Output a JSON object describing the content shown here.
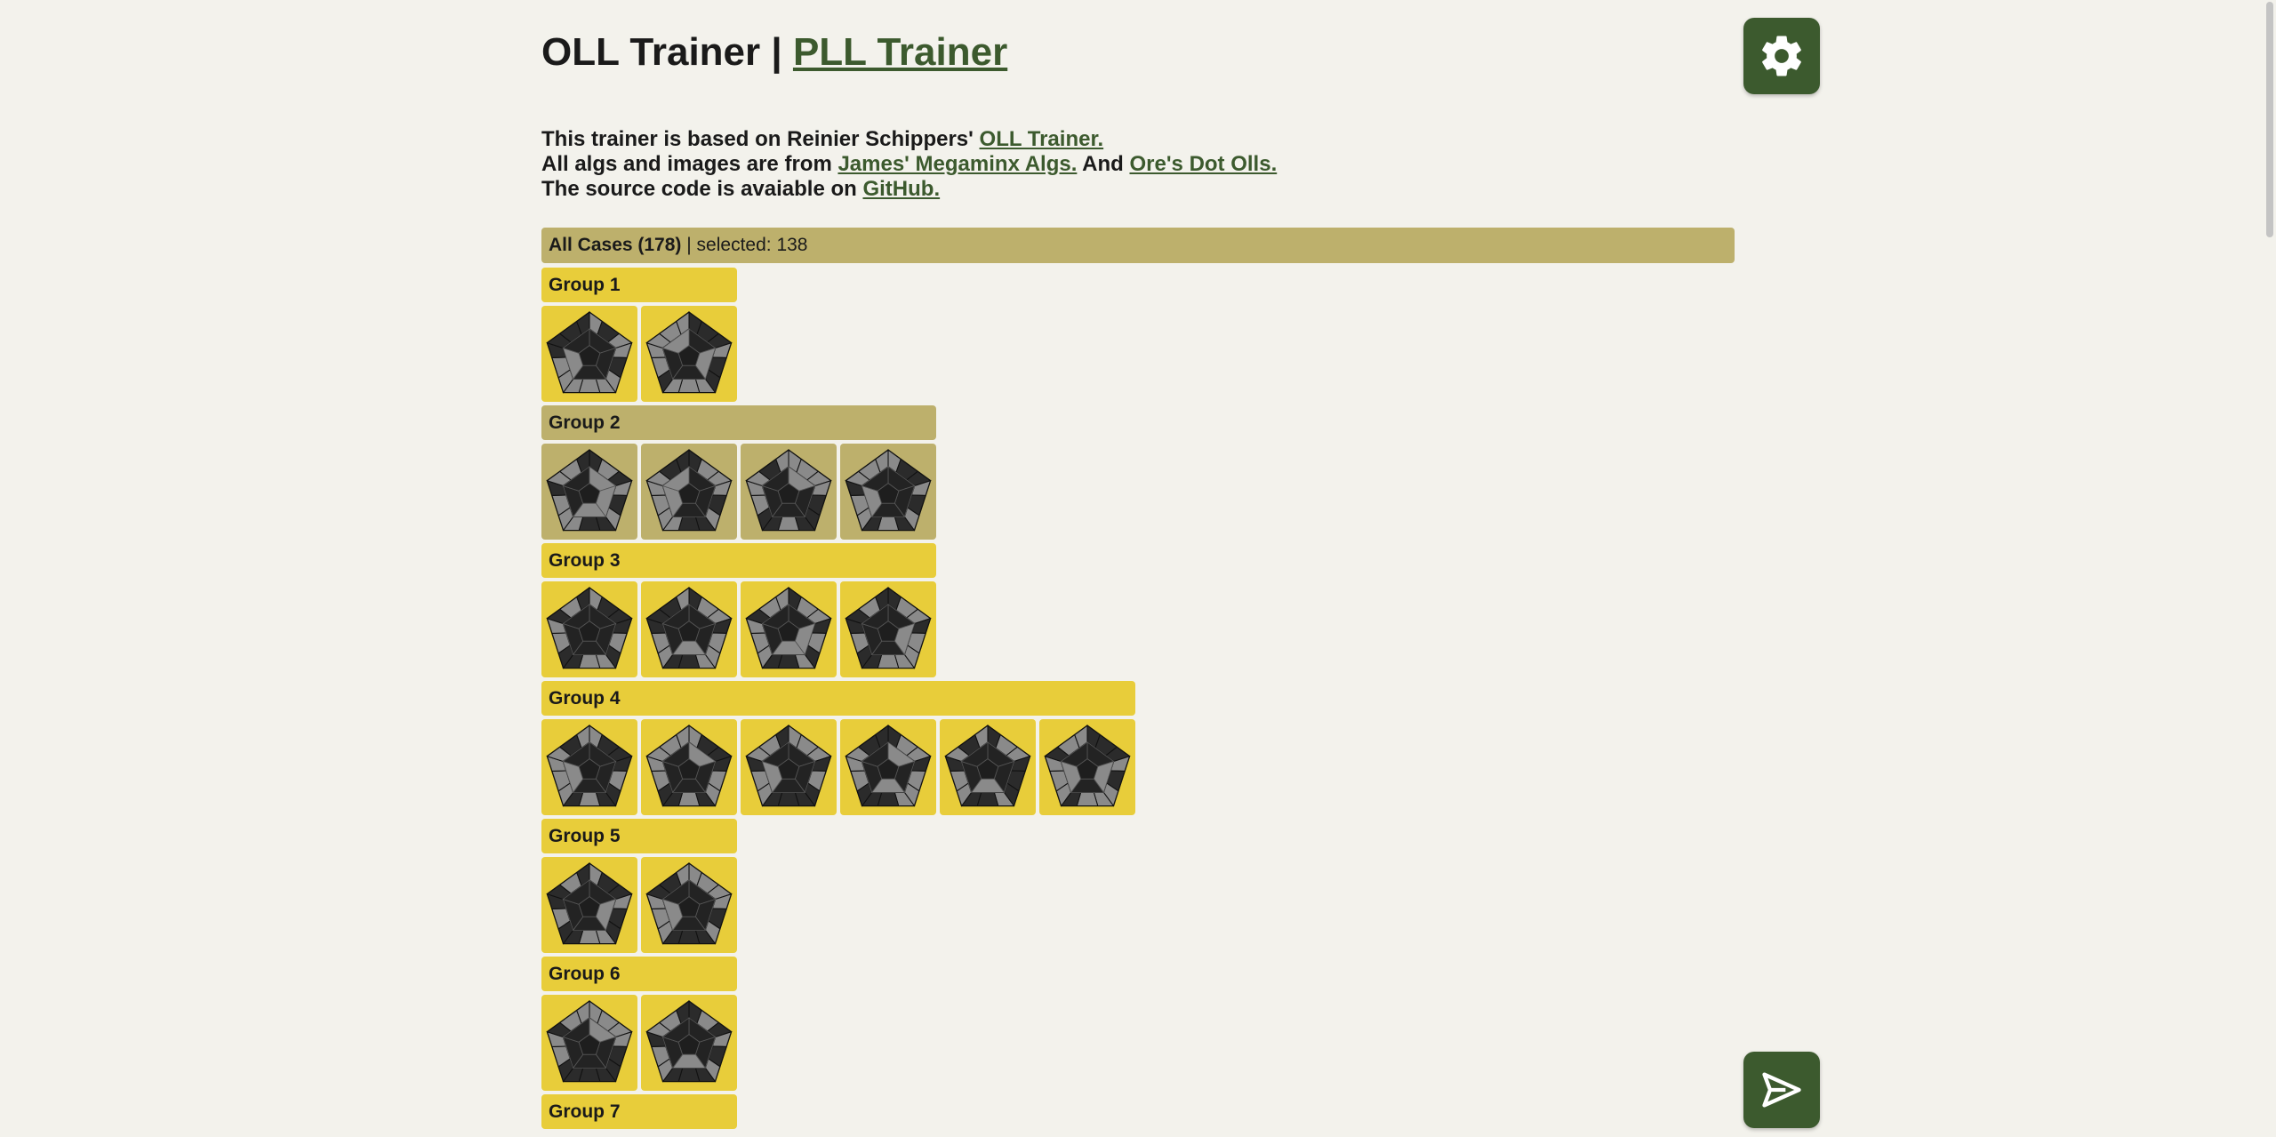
{
  "header": {
    "title": "OLL Trainer",
    "separator": "|",
    "pll_link": "PLL Trainer"
  },
  "intro": {
    "line1_text": "This trainer is based on Reinier Schippers'",
    "line1_link": "OLL Trainer.",
    "line2_text": "All algs and images are from",
    "line2_link1": "James' Megaminx Algs.",
    "line2_and": "And",
    "line2_link2": "Ore's Dot Olls.",
    "line3_text": "The source code is avaiable on",
    "line3_link": "GitHub."
  },
  "all_cases": {
    "label": "All Cases (178)",
    "selected": "| selected: 138"
  },
  "groups": [
    {
      "label": "Group 1",
      "selected": true,
      "cases": [
        1,
        2
      ]
    },
    {
      "label": "Group 2",
      "selected": false,
      "cases": [
        3,
        4,
        5,
        6
      ]
    },
    {
      "label": "Group 3",
      "selected": true,
      "cases": [
        7,
        8,
        9,
        10
      ]
    },
    {
      "label": "Group 4",
      "selected": true,
      "cases": [
        11,
        12,
        13,
        14,
        15,
        16
      ]
    },
    {
      "label": "Group 5",
      "selected": true,
      "cases": [
        17,
        18
      ]
    },
    {
      "label": "Group 6",
      "selected": true,
      "cases": [
        19,
        20
      ]
    },
    {
      "label": "Group 7",
      "selected": true,
      "cases": []
    }
  ],
  "icons": {
    "settings": "gear-icon",
    "start": "send-icon"
  },
  "colors": {
    "accent": "#3c5a2e",
    "selected": "#e8cd3a",
    "unselected": "#bdb06c",
    "background": "#f3f2ec"
  }
}
